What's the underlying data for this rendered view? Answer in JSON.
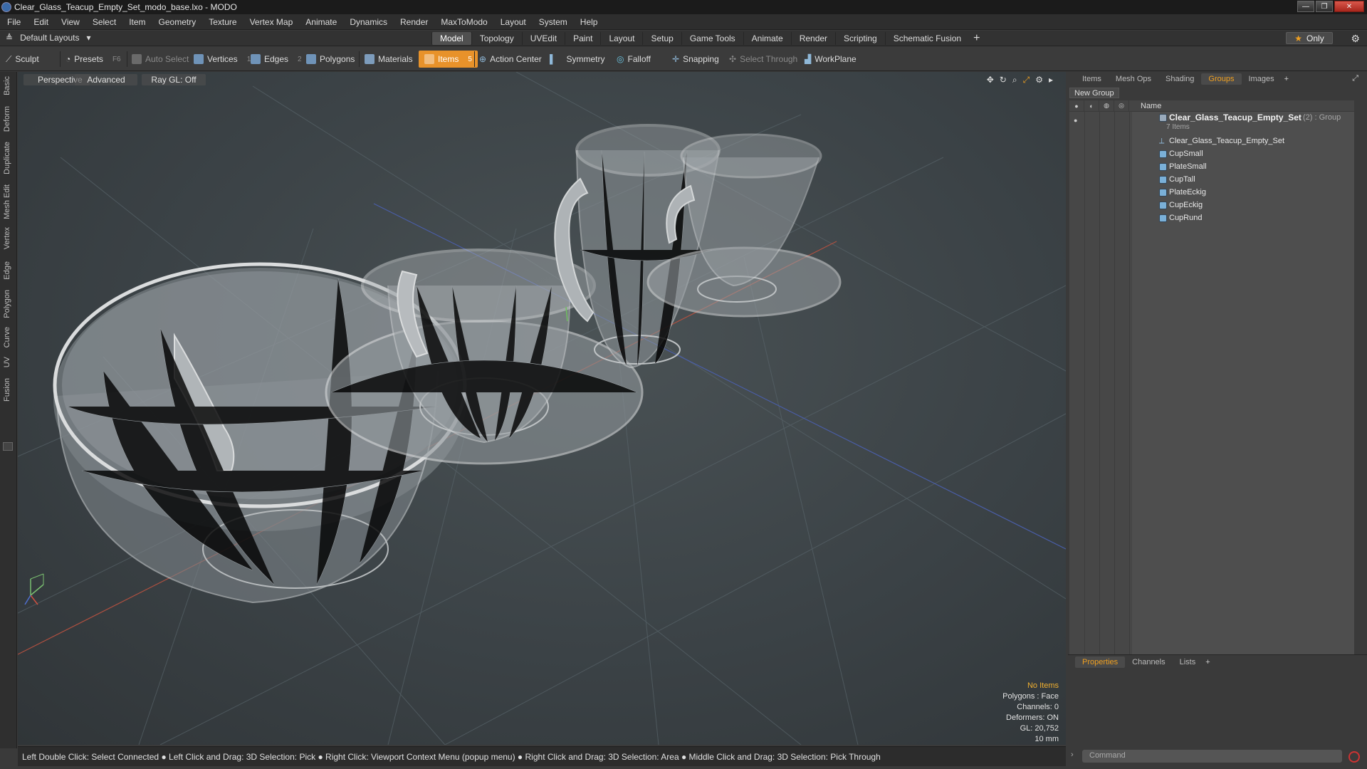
{
  "window": {
    "title": "Clear_Glass_Teacup_Empty_Set_modo_base.lxo - MODO",
    "controls": [
      "—",
      "❐",
      "✕"
    ]
  },
  "menu": [
    "File",
    "Edit",
    "View",
    "Select",
    "Item",
    "Geometry",
    "Texture",
    "Vertex Map",
    "Animate",
    "Dynamics",
    "Render",
    "MaxToModo",
    "Layout",
    "System",
    "Help"
  ],
  "layout": {
    "selector": "Default Layouts",
    "tabs": [
      "Model",
      "Topology",
      "UVEdit",
      "Paint",
      "Layout",
      "Setup",
      "Game Tools",
      "Animate",
      "Render",
      "Scripting",
      "Schematic Fusion"
    ],
    "active_tab": "Model",
    "only_label": "Only"
  },
  "toolbar": {
    "sculpt": "Sculpt",
    "presets": "Presets",
    "presets_key": "F6",
    "auto_select": "Auto Select",
    "vertices": "Vertices",
    "vertices_key": "1",
    "edges": "Edges",
    "edges_key": "2",
    "polygons": "Polygons",
    "materials": "Materials",
    "items": "Items",
    "items_key": "5",
    "action_center": "Action Center",
    "symmetry": "Symmetry",
    "falloff": "Falloff",
    "snapping": "Snapping",
    "select_through": "Select Through",
    "workplane": "WorkPlane"
  },
  "left_tabs": [
    "Basic",
    "Deform",
    "Duplicate",
    "Mesh Edit",
    "Vertex",
    "Edge",
    "Polygon",
    "Curve",
    "UV",
    "Fusion"
  ],
  "viewport": {
    "view": "Perspective",
    "shading": "Advanced",
    "raygl": "Ray GL: Off",
    "stats": {
      "items": "No Items",
      "polygons": "Polygons : Face",
      "channels": "Channels: 0",
      "deformers": "Deformers: ON",
      "gl": "GL: 20,752",
      "scale": "10 mm"
    }
  },
  "statusbar": "Left Double Click: Select Connected ● Left Click and Drag: 3D Selection: Pick ● Right Click: Viewport Context Menu (popup menu) ● Right Click and Drag: 3D Selection: Area ● Middle Click and Drag: 3D Selection: Pick Through",
  "right_panel": {
    "tabs": [
      "Items",
      "Mesh Ops",
      "Shading",
      "Groups",
      "Images"
    ],
    "active_tab": "Groups",
    "new_group": "New Group",
    "name_header": "Name",
    "group": {
      "name": "Clear_Glass_Teacup_Empty_Set",
      "suffix": "(2) : Group",
      "count": "7 Items",
      "children": [
        "Clear_Glass_Teacup_Empty_Set",
        "CupSmall",
        "PlateSmall",
        "CupTall",
        "PlateEckig",
        "CupEckig",
        "CupRund"
      ]
    },
    "bottom_tabs": [
      "Properties",
      "Channels",
      "Lists"
    ],
    "bottom_active": "Properties",
    "command_placeholder": "Command"
  },
  "colors": {
    "accent": "#e8922a",
    "active_tab_text": "#f0a020"
  }
}
